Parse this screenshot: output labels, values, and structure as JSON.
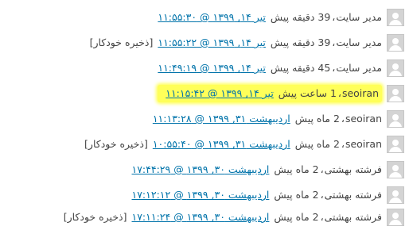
{
  "revisions": [
    {
      "author": "مدیر سایت",
      "ago": "39 دقیقه پیش",
      "link": "تیر ۱۴, ۱۳۹۹ @ ۱۱:۵۵:۳۰",
      "autosave": "",
      "highlight": false
    },
    {
      "author": "مدیر سایت",
      "ago": "39 دقیقه پیش",
      "link": "تیر ۱۴, ۱۳۹۹ @ ۱۱:۵۵:۲۲",
      "autosave": "[ذخیره خودکار]",
      "highlight": false
    },
    {
      "author": "مدیر سایت",
      "ago": "45 دقیقه پیش",
      "link": "تیر ۱۴, ۱۳۹۹ @ ۱۱:۴۹:۱۹",
      "autosave": "",
      "highlight": false
    },
    {
      "author": "seoiran",
      "ago": "1 ساعت پیش",
      "link": "تیر ۱۴, ۱۳۹۹ @ ۱۱:۱۵:۴۲",
      "autosave": "",
      "highlight": true
    },
    {
      "author": "seoiran",
      "ago": "2 ماه پیش",
      "link": "اردیبهشت ۳۱, ۱۳۹۹ @ ۱۱:۱۳:۲۸",
      "autosave": "",
      "highlight": false
    },
    {
      "author": "seoiran",
      "ago": "2 ماه پیش",
      "link": "اردیبهشت ۳۱, ۱۳۹۹ @ ۱۰:۵۵:۴۰",
      "autosave": "[ذخیره خودکار]",
      "highlight": false
    },
    {
      "author": "فرشته بهشتی",
      "ago": "2 ماه پیش",
      "link": "اردیبهشت ۳۰, ۱۳۹۹ @ ۱۷:۴۴:۲۹",
      "autosave": "",
      "highlight": false
    },
    {
      "author": "فرشته بهشتی",
      "ago": "2 ماه پیش",
      "link": "اردیبهشت ۳۰, ۱۳۹۹ @ ۱۷:۱۲:۱۲",
      "autosave": "",
      "highlight": false
    },
    {
      "author": "فرشته بهشتی",
      "ago": "2 ماه پیش",
      "link": "اردیبهشت ۳۰, ۱۳۹۹ @ ۱۷:۱۱:۲۴",
      "autosave": "[ذخیره خودکار]",
      "highlight": false
    }
  ],
  "colors": {
    "link": "#0073aa",
    "text": "#444444",
    "highlight": "#ffff59",
    "avatar": "#d4d4d4"
  }
}
